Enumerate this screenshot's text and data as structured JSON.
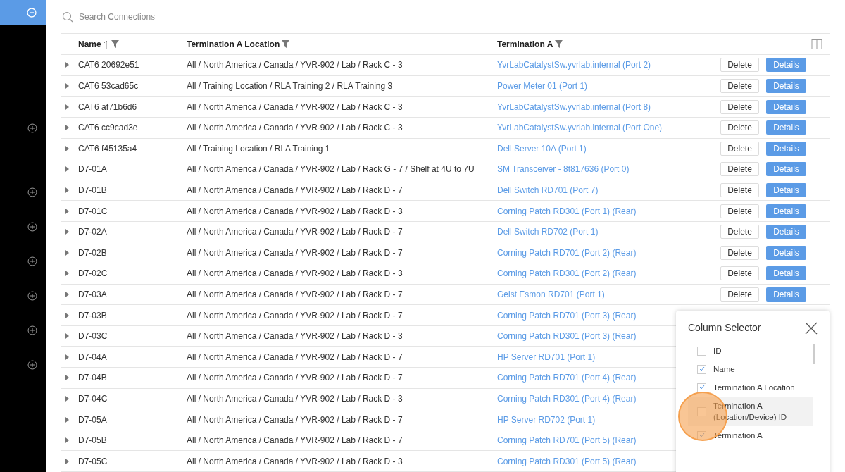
{
  "search": {
    "placeholder": "Search Connections"
  },
  "table": {
    "columns": [
      {
        "label": "Name",
        "sorted": true,
        "filter": true
      },
      {
        "label": "Termination A Location",
        "sorted": false,
        "filter": true
      },
      {
        "label": "Termination A",
        "sorted": false,
        "filter": true
      }
    ],
    "rows": [
      {
        "name": "CAT6 20692e51",
        "location": "All / North America / Canada / YVR-902 / Lab / Rack C - 3",
        "termination": "YvrLabCatalystSw.yvrlab.internal (Port 2)",
        "actions": [
          "Delete",
          "Details"
        ]
      },
      {
        "name": "CAT6 53cad65c",
        "location": "All / Training Location / RLA Training 2 / RLA Training 3",
        "termination": "Power Meter 01 (Port 1)",
        "actions": [
          "Delete",
          "Details"
        ]
      },
      {
        "name": "CAT6 af71b6d6",
        "location": "All / North America / Canada / YVR-902 / Lab / Rack C - 3",
        "termination": "YvrLabCatalystSw.yvrlab.internal (Port 8)",
        "actions": [
          "Delete",
          "Details"
        ]
      },
      {
        "name": "CAT6 cc9cad3e",
        "location": "All / North America / Canada / YVR-902 / Lab / Rack C - 3",
        "termination": "YvrLabCatalystSw.yvrlab.internal (Port One)",
        "actions": [
          "Delete",
          "Details"
        ]
      },
      {
        "name": "CAT6 f45135a4",
        "location": "All / Training Location / RLA Training 1",
        "termination": "Dell Server 10A (Port 1)",
        "actions": [
          "Delete",
          "Details"
        ]
      },
      {
        "name": "D7-01A",
        "location": "All / North America / Canada / YVR-902 / Lab / Rack G - 7 / Shelf at 4U to 7U",
        "termination": "SM Transceiver - 8t817636 (Port 0)",
        "actions": [
          "Delete",
          "Details"
        ]
      },
      {
        "name": "D7-01B",
        "location": "All / North America / Canada / YVR-902 / Lab / Rack D - 7",
        "termination": "Dell Switch RD701 (Port 7)",
        "actions": [
          "Delete",
          "Details"
        ]
      },
      {
        "name": "D7-01C",
        "location": "All / North America / Canada / YVR-902 / Lab / Rack D - 3",
        "termination": "Corning Patch RD301 (Port 1) (Rear)",
        "actions": [
          "Delete",
          "Details"
        ]
      },
      {
        "name": "D7-02A",
        "location": "All / North America / Canada / YVR-902 / Lab / Rack D - 7",
        "termination": "Dell Switch RD702 (Port 1)",
        "actions": [
          "Delete",
          "Details"
        ]
      },
      {
        "name": "D7-02B",
        "location": "All / North America / Canada / YVR-902 / Lab / Rack D - 7",
        "termination": "Corning Patch RD701 (Port 2) (Rear)",
        "actions": [
          "Delete",
          "Details"
        ]
      },
      {
        "name": "D7-02C",
        "location": "All / North America / Canada / YVR-902 / Lab / Rack D - 3",
        "termination": "Corning Patch RD301 (Port 2) (Rear)",
        "actions": [
          "Delete",
          "Details"
        ]
      },
      {
        "name": "D7-03A",
        "location": "All / North America / Canada / YVR-902 / Lab / Rack D - 7",
        "termination": "Geist Esmon RD701 (Port 1)",
        "actions": [
          "Delete",
          "Details"
        ]
      },
      {
        "name": "D7-03B",
        "location": "All / North America / Canada / YVR-902 / Lab / Rack D - 7",
        "termination": "Corning Patch RD701 (Port 3) (Rear)"
      },
      {
        "name": "D7-03C",
        "location": "All / North America / Canada / YVR-902 / Lab / Rack D - 3",
        "termination": "Corning Patch RD301 (Port 3) (Rear)"
      },
      {
        "name": "D7-04A",
        "location": "All / North America / Canada / YVR-902 / Lab / Rack D - 7",
        "termination": "HP Server RD701 (Port 1)"
      },
      {
        "name": "D7-04B",
        "location": "All / North America / Canada / YVR-902 / Lab / Rack D - 7",
        "termination": "Corning Patch RD701 (Port 4) (Rear)"
      },
      {
        "name": "D7-04C",
        "location": "All / North America / Canada / YVR-902 / Lab / Rack D - 3",
        "termination": "Corning Patch RD301 (Port 4) (Rear)"
      },
      {
        "name": "D7-05A",
        "location": "All / North America / Canada / YVR-902 / Lab / Rack D - 7",
        "termination": "HP Server RD702 (Port 1)"
      },
      {
        "name": "D7-05B",
        "location": "All / North America / Canada / YVR-902 / Lab / Rack D - 7",
        "termination": "Corning Patch RD701 (Port 5) (Rear)"
      },
      {
        "name": "D7-05C",
        "location": "All / North America / Canada / YVR-902 / Lab / Rack D - 3",
        "termination": "Corning Patch RD301 (Port 5) (Rear)"
      }
    ]
  },
  "column_selector": {
    "title": "Column Selector",
    "items": [
      {
        "label": "ID",
        "checked": false,
        "highlighted": false
      },
      {
        "label": "Name",
        "checked": true,
        "highlighted": false
      },
      {
        "label": "Termination A Location",
        "checked": true,
        "highlighted": false
      },
      {
        "label": "Termination A (Location/Device) ID",
        "checked": false,
        "highlighted": true
      },
      {
        "label": "Termination A",
        "checked": true,
        "highlighted": false
      }
    ]
  }
}
